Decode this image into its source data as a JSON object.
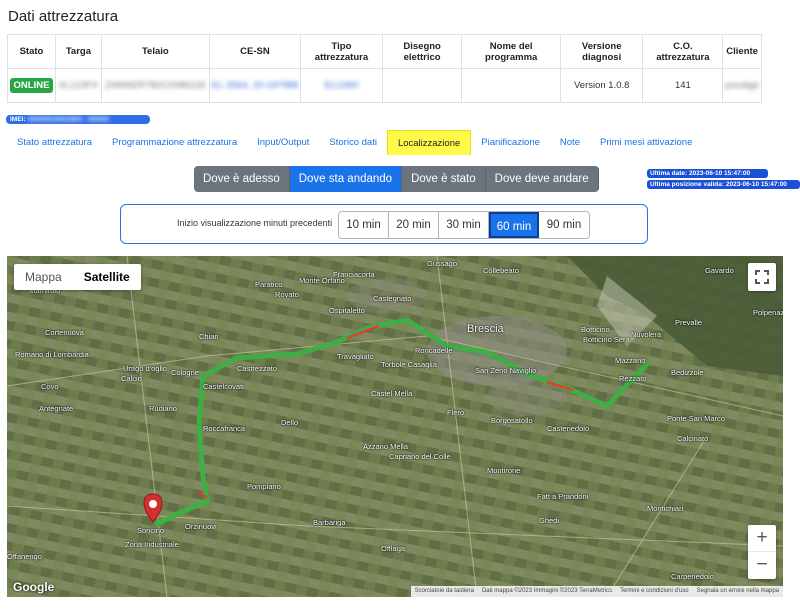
{
  "page": {
    "title": "Dati attrezzatura"
  },
  "table": {
    "headers": [
      "Stato",
      "Targa",
      "Telaio",
      "CE-SN",
      "Tipo attrezzatura",
      "Disegno elettrico",
      "Nome del programma",
      "Versione diagnosi",
      "C.O. attrezzatura",
      "Cliente"
    ],
    "row": {
      "stato": "ONLINE",
      "targa": "XL123FX",
      "telaio": "ZAWAER7B0C0086226",
      "ce_sn": "EL-3564, 20-197988",
      "tipo": "ELU360",
      "disegno": "",
      "programma": "",
      "versione": "Version 1.0.8",
      "co": "141",
      "cliente": "prestige"
    }
  },
  "imei": {
    "label": "IMEI:",
    "value": "356938035643809 - 350000"
  },
  "tabs": [
    {
      "label": "Stato attrezzatura",
      "active": false
    },
    {
      "label": "Programmazione attrezzatura",
      "active": false
    },
    {
      "label": "Input/Output",
      "active": false
    },
    {
      "label": "Storico dati",
      "active": false
    },
    {
      "label": "Localizzazione",
      "active": true
    },
    {
      "label": "Pianificazione",
      "active": false
    },
    {
      "label": "Note",
      "active": false
    },
    {
      "label": "Primi mesi attivazione",
      "active": false
    }
  ],
  "view_modes": [
    {
      "label": "Dove è adesso",
      "active": false
    },
    {
      "label": "Dove sta andando",
      "active": true
    },
    {
      "label": "Dove è stato",
      "active": false
    },
    {
      "label": "Dove deve andare",
      "active": false
    }
  ],
  "info": {
    "last_date": "Ultima date: 2023-06-10 15:47:00",
    "last_position": "Ultima posizione valida: 2023-06-10 15:47:00"
  },
  "minutes": {
    "label": "Inizio visualizzazione minuti precedenti",
    "options": [
      {
        "label": "10 min",
        "active": false
      },
      {
        "label": "20 min",
        "active": false
      },
      {
        "label": "30 min",
        "active": false
      },
      {
        "label": "60 min",
        "active": true
      },
      {
        "label": "90 min",
        "active": false
      }
    ]
  },
  "map": {
    "type_buttons": [
      {
        "label": "Mappa",
        "active": false
      },
      {
        "label": "Satellite",
        "active": true
      }
    ],
    "zoom_in": "+",
    "zoom_out": "−",
    "google": "Google",
    "attribution": [
      "Scorciatoie da tastiera",
      "Dati mappa ©2023 Immagini ©2023 TerraMetrics",
      "Termini e condizioni d'uso",
      "Segnala un errore nella mappa"
    ],
    "route_color": "#3cb043",
    "route_alert_color": "#e53935",
    "marker_color": "#d32f2f",
    "places": [
      "Marhirolo",
      "Paratico",
      "Gussago",
      "Collebeato",
      "Gavardo",
      "Cortenuova",
      "Franciacorta",
      "Rovato",
      "Monte Orfano",
      "Ospitaletto",
      "Castegnato",
      "Brescia",
      "Botticino",
      "Nuvolera",
      "Prevalle",
      "Polpenazze del Garda",
      "Romano di Lombardia",
      "Chiari",
      "Urago d'oglio",
      "Castrezzato",
      "Travagliato",
      "Roncadelle",
      "Botticino Sera",
      "Mazzano",
      "Bedizzole",
      "Covo",
      "Calcio",
      "Cologne",
      "Castelcovati",
      "Torbole Casaglia",
      "San Zeno Naviglio",
      "Rezzato",
      "Antegnate",
      "Rudiano",
      "Castel Mella",
      "Flero",
      "Borgosatollo",
      "Castenedolo",
      "Ponte San Marco",
      "Calcinato",
      "Roccafranca",
      "Dello",
      "Azzano Mella",
      "Capriano del Colle",
      "Montirone",
      "Pompiano",
      "Orzinuovi",
      "Fatt a Prandoni",
      "Montichiari",
      "Zona Industriale",
      "Barbariga",
      "Offlaga",
      "Ghedi",
      "Carpenedolo",
      "Offanengo",
      "Soncino"
    ]
  }
}
